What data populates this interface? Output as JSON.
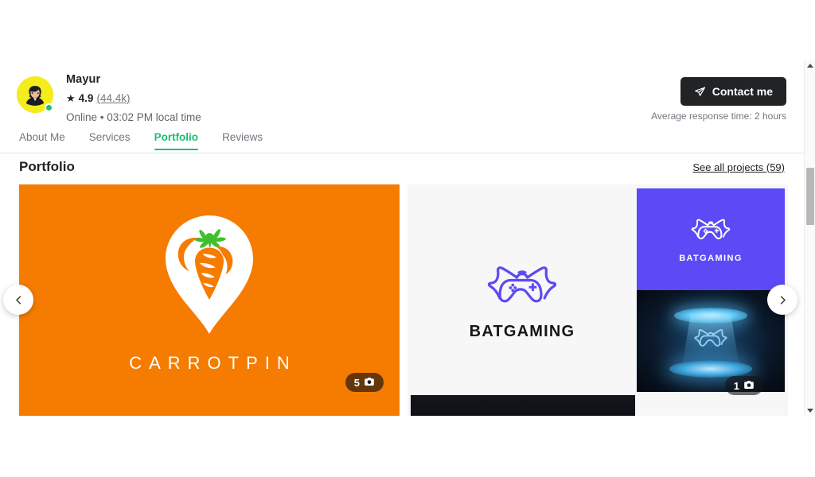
{
  "profile": {
    "name": "Mayur",
    "rating_value": "4.9",
    "rating_count": "(44.4k)",
    "status": "Online • 03:02 PM local time",
    "star_icon": "star-icon",
    "avatar_icon": "avatar",
    "online_indicator": "online-dot"
  },
  "actions": {
    "contact_label": "Contact me",
    "contact_icon": "send-icon",
    "response_time": "Average response time: 2 hours"
  },
  "tabs": [
    {
      "label": "About Me",
      "active": false
    },
    {
      "label": "Services",
      "active": false
    },
    {
      "label": "Portfolio",
      "active": true
    },
    {
      "label": "Reviews",
      "active": false
    }
  ],
  "portfolio": {
    "title": "Portfolio",
    "see_all_label": "See all projects (59)",
    "prev_icon": "chevron-left-icon",
    "next_icon": "chevron-right-icon",
    "cards": [
      {
        "name": "carrotpin-project",
        "wordmark": "CARROTPIN",
        "image_count": "5",
        "count_icon": "camera-icon",
        "background": "#F57C00"
      },
      {
        "name": "batgaming-project",
        "wordmark": "BATGAMING",
        "wordmark_small": "BATGAMING",
        "image_count": "1",
        "count_icon": "camera-icon",
        "background": "#F7F7F7",
        "accent": "#5B4AF5"
      }
    ]
  },
  "colors": {
    "accent_green": "#1DBF73",
    "orange": "#F57C00",
    "purple": "#5B4AF5",
    "dark": "#222325"
  },
  "scrollbar": {
    "up_icon": "scroll-up-arrow-icon",
    "down_icon": "scroll-down-arrow-icon"
  }
}
